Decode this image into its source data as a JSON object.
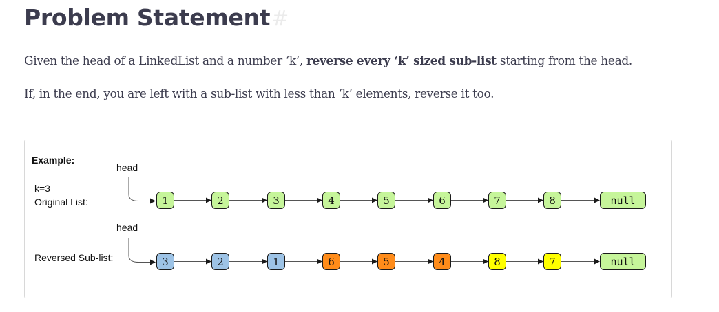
{
  "title": "Problem Statement",
  "anchor": "#",
  "paragraph1": {
    "a": "Given the head of a LinkedList and a number ‘k’, ",
    "b": "reverse every ‘k’ sized sub-list",
    "c": " starting from the head."
  },
  "paragraph2": "If, in the end, you are left with a sub-list with less than ‘k’ elements, reverse it too.",
  "example": {
    "heading": "Example:",
    "k_label": "k=3",
    "original_label": "Original List:",
    "reversed_label": "Reversed Sub-list:",
    "head_label": "head",
    "original_nodes": [
      {
        "value": "1",
        "color": "#c6f59a"
      },
      {
        "value": "2",
        "color": "#c6f59a"
      },
      {
        "value": "3",
        "color": "#c6f59a"
      },
      {
        "value": "4",
        "color": "#c6f59a"
      },
      {
        "value": "5",
        "color": "#c6f59a"
      },
      {
        "value": "6",
        "color": "#c6f59a"
      },
      {
        "value": "7",
        "color": "#c6f59a"
      },
      {
        "value": "8",
        "color": "#c6f59a"
      },
      {
        "value": "null",
        "color": "#c6f59a"
      }
    ],
    "reversed_nodes": [
      {
        "value": "3",
        "color": "#9dc3e6"
      },
      {
        "value": "2",
        "color": "#9dc3e6"
      },
      {
        "value": "1",
        "color": "#9dc3e6"
      },
      {
        "value": "6",
        "color": "#ff8c1a"
      },
      {
        "value": "5",
        "color": "#ff8c1a"
      },
      {
        "value": "4",
        "color": "#ff8c1a"
      },
      {
        "value": "8",
        "color": "#ffff00"
      },
      {
        "value": "7",
        "color": "#ffff00"
      },
      {
        "value": "null",
        "color": "#c6f59a"
      }
    ]
  }
}
